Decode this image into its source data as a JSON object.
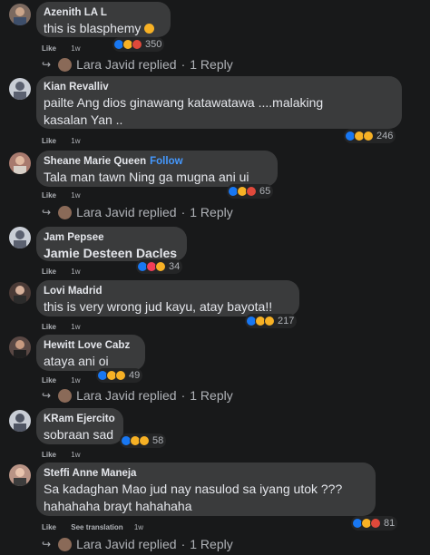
{
  "comments": [
    {
      "name": "Azenith LA L",
      "text": "this is blasphemy",
      "like": "Like",
      "time": "1w",
      "reaction_count": "350",
      "reply": {
        "author": "Lara Javid",
        "verb": "replied",
        "count": "1 Reply"
      }
    },
    {
      "name": "Kian Revalliv",
      "line1": "pailte Ang dios ginawang katawatawa ....malaking",
      "line2": "kasalan Yan ..",
      "like": "Like",
      "time": "1w",
      "reaction_count": "246"
    },
    {
      "name": "Sheane Marie Queen",
      "follow": "Follow",
      "text": "Tala man tawn Ning ga mugna ani ui",
      "like": "Like",
      "time": "1w",
      "reaction_count": "65",
      "reply": {
        "author": "Lara Javid",
        "verb": "replied",
        "count": "1 Reply"
      }
    },
    {
      "name": "Jam Pepsee",
      "text": "Jamie Desteen Dacles",
      "like": "Like",
      "time": "1w",
      "reaction_count": "34"
    },
    {
      "name": "Lovi Madrid",
      "text": "this is very wrong jud kayu, atay bayota!!",
      "like": "Like",
      "time": "1w",
      "reaction_count": "217"
    },
    {
      "name": "Hewitt Love Cabz",
      "text": "ataya ani oi",
      "like": "Like",
      "time": "1w",
      "reaction_count": "49",
      "reply": {
        "author": "Lara Javid",
        "verb": "replied",
        "count": "1 Reply"
      }
    },
    {
      "name": "KRam Ejercito",
      "text": "sobraan sad",
      "like": "Like",
      "time": "1w",
      "reaction_count": "58"
    },
    {
      "name": "Steffi Anne Maneja",
      "line1": "Sa kadaghan Mao jud nay nasulod sa iyang utok ???",
      "line2": "hahahaha brayt hahahaha",
      "like": "Like",
      "see_translation": "See translation",
      "time": "1w",
      "reaction_count": "81",
      "reply": {
        "author": "Lara Javid",
        "verb": "replied",
        "count": "1 Reply"
      }
    }
  ],
  "colors": {
    "background": "#18191a",
    "bubble": "#3a3b3c",
    "text": "#e4e6eb",
    "muted": "#b0b3b8",
    "follow": "#4599ff",
    "like_blue": "#1877f2",
    "haha_yellow": "#f7b125"
  },
  "icons": {
    "reply_arrow": "reply-arrow-icon",
    "like_reaction": "like-reaction-icon",
    "haha_reaction": "haha-reaction-icon",
    "sad_reaction": "sad-reaction-icon",
    "angry_reaction": "angry-reaction-icon",
    "love_reaction": "love-reaction-icon",
    "grimace_emoji": "grimace-emoji-icon"
  }
}
